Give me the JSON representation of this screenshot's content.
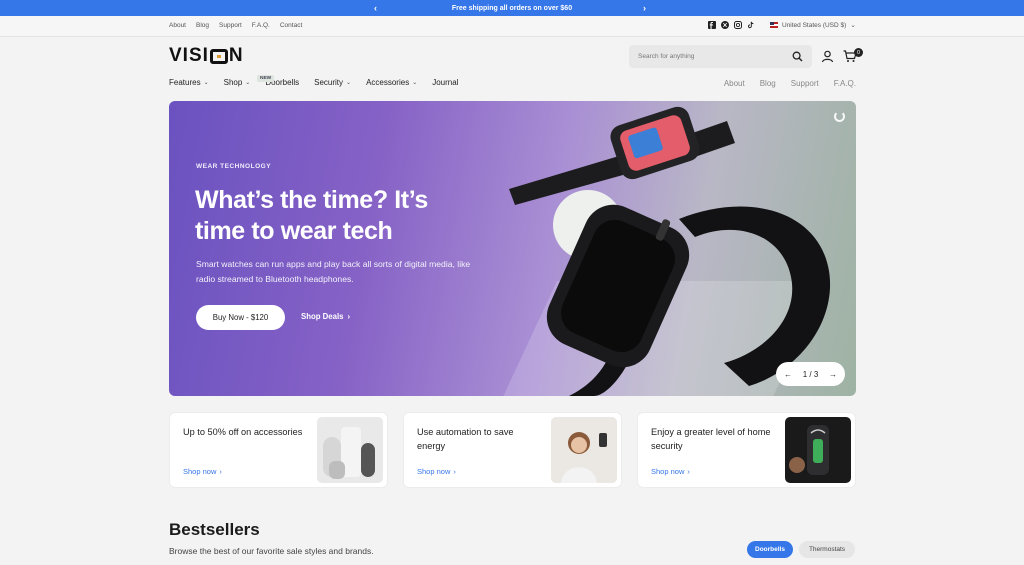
{
  "announcement": {
    "text": "Free shipping all orders on over $60",
    "prev_icon": "chevron-left-icon",
    "next_icon": "chevron-right-icon"
  },
  "utility": {
    "links": [
      "About",
      "Blog",
      "Support",
      "F.A.Q.",
      "Contact"
    ],
    "socials": [
      "facebook-icon",
      "x-icon",
      "instagram-icon",
      "tiktok-icon"
    ],
    "currency": "United States (USD $)"
  },
  "header": {
    "logo": "VISION",
    "search_placeholder": "Search for anything",
    "cart_count": "0"
  },
  "nav": {
    "items": [
      {
        "label": "Features",
        "has_dropdown": true
      },
      {
        "label": "Shop",
        "has_dropdown": true,
        "badge": "NEW"
      },
      {
        "label": "Doorbells",
        "has_dropdown": false
      },
      {
        "label": "Security",
        "has_dropdown": true
      },
      {
        "label": "Accessories",
        "has_dropdown": true
      },
      {
        "label": "Journal",
        "has_dropdown": false
      }
    ],
    "right": [
      "About",
      "Blog",
      "Support",
      "F.A.Q."
    ]
  },
  "hero": {
    "eyebrow": "WEAR TECHNOLOGY",
    "headline": "What’s the time? It’s time to wear tech",
    "subcopy": "Smart watches can run apps and play back all sorts of digital media, like radio streamed to Bluetooth headphones.",
    "primary_cta": "Buy Now - $120",
    "secondary_cta": "Shop Deals",
    "slide_indicator": "1 / 3",
    "colors": {
      "from": "#6a52c0",
      "to": "#9eb3a3"
    }
  },
  "promos": [
    {
      "title": "Up to 50% off on accessories",
      "cta": "Shop now"
    },
    {
      "title": "Use automation to save energy",
      "cta": "Shop now"
    },
    {
      "title": "Enjoy a greater level of home security",
      "cta": "Shop now"
    }
  ],
  "bestsellers": {
    "title": "Bestsellers",
    "subtitle": "Browse the best of our favorite sale styles and brands.",
    "tabs": [
      {
        "label": "Doorbells",
        "active": true
      },
      {
        "label": "Thermostats",
        "active": false
      }
    ]
  },
  "colors": {
    "accent": "#3576e8",
    "background": "#f3f3f3"
  }
}
